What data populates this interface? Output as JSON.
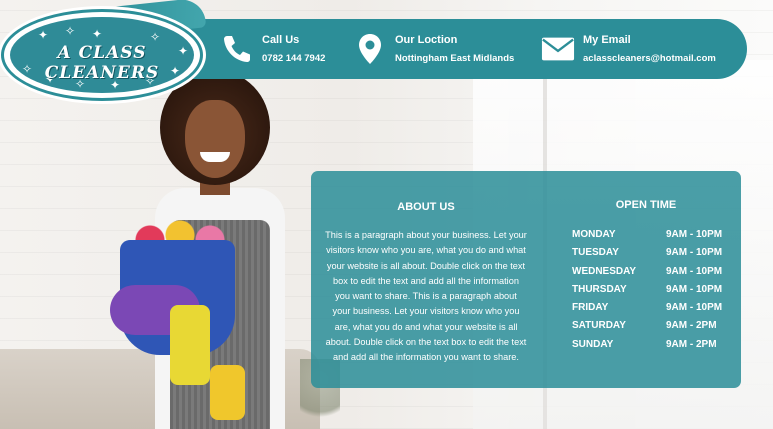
{
  "brand": {
    "logo_text": "A CLASS CLEANERS",
    "accent_color": "#2c8e98"
  },
  "contact": {
    "phone": {
      "label": "Call Us",
      "value": "0782 144 7942",
      "icon": "phone-icon"
    },
    "location": {
      "label": "Our Loction",
      "value": "Nottingham East Midlands",
      "icon": "location-pin-icon"
    },
    "email": {
      "label": "My Email",
      "value": "aclasscleaners@hotmail.com",
      "icon": "envelope-icon"
    }
  },
  "about": {
    "title": "ABOUT US",
    "text": "This is a paragraph about your business. Let your visitors know who you are, what you do and what your website is all about. Double click on the text box to edit the text and add all the information you want to share. This is a paragraph about your business. Let your visitors know who you are, what you do and what your website is all about. Double click on the text box to edit the text and add all the information you want to share."
  },
  "open_time": {
    "title": "OPEN TIME",
    "rows": [
      {
        "day": "MONDAY",
        "time": "9AM - 10PM"
      },
      {
        "day": "TUESDAY",
        "time": "9AM - 10PM"
      },
      {
        "day": "WEDNESDAY",
        "time": "9AM - 10PM"
      },
      {
        "day": "THURSDAY",
        "time": "9AM - 10PM"
      },
      {
        "day": "FRIDAY",
        "time": "9AM - 10PM"
      },
      {
        "day": "SATURDAY",
        "time": "9AM - 2PM"
      },
      {
        "day": "SUNDAY",
        "time": "9AM - 2PM"
      }
    ]
  }
}
